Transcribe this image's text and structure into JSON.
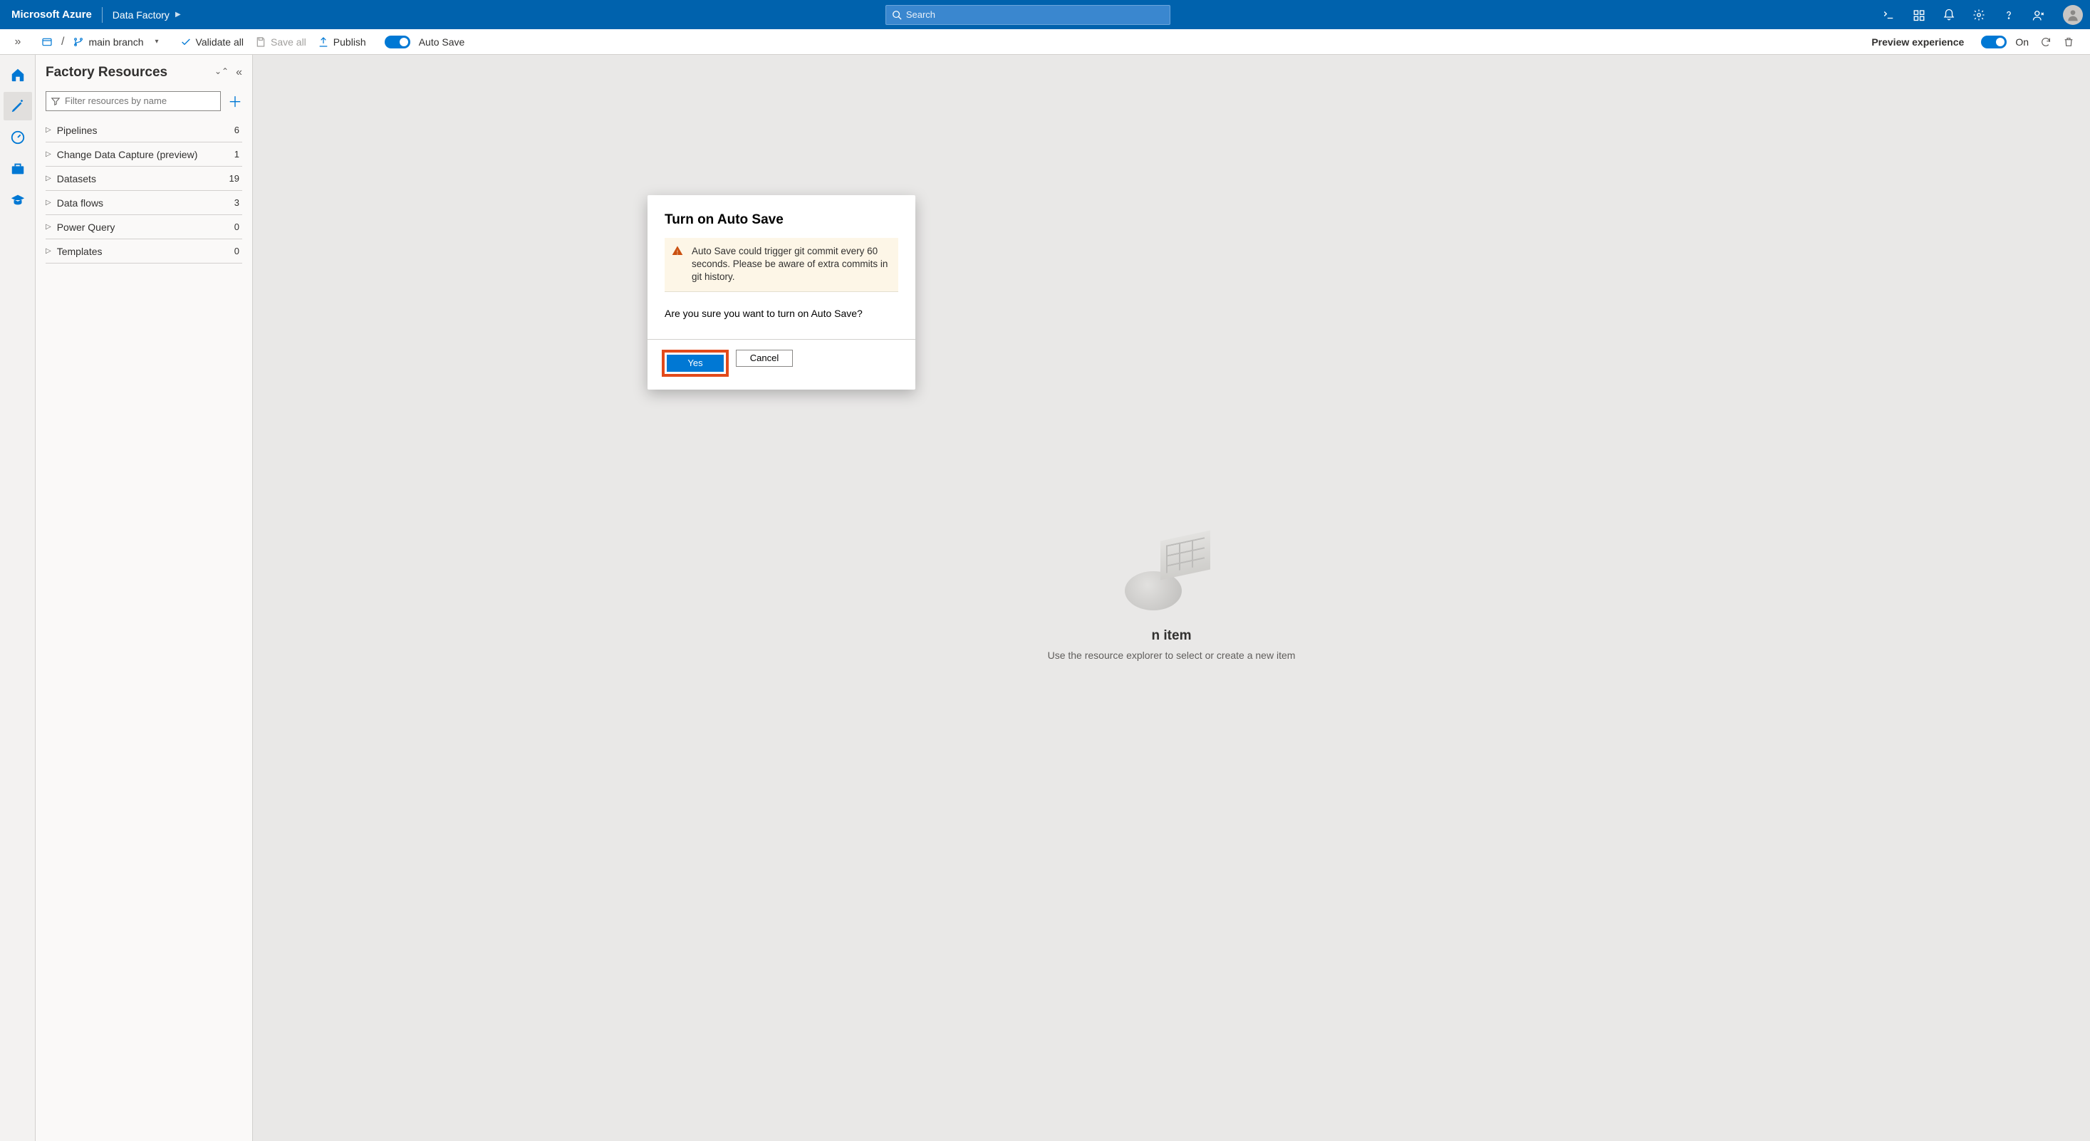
{
  "brand": "Microsoft Azure",
  "breadcrumb": {
    "service": "Data Factory"
  },
  "search": {
    "placeholder": "Search"
  },
  "toolbar": {
    "branch_label": "main branch",
    "validate_label": "Validate all",
    "save_label": "Save all",
    "publish_label": "Publish",
    "autosave_label": "Auto Save",
    "preview_label": "Preview experience",
    "preview_state": "On"
  },
  "panel": {
    "title": "Factory Resources",
    "filter_placeholder": "Filter resources by name",
    "items": [
      {
        "label": "Pipelines",
        "count": "6"
      },
      {
        "label": "Change Data Capture (preview)",
        "count": "1"
      },
      {
        "label": "Datasets",
        "count": "19"
      },
      {
        "label": "Data flows",
        "count": "3"
      },
      {
        "label": "Power Query",
        "count": "0"
      },
      {
        "label": "Templates",
        "count": "0"
      }
    ]
  },
  "canvas": {
    "empty_title_suffix": "n item",
    "empty_sub": "Use the resource explorer to select or create a new item"
  },
  "dialog": {
    "title": "Turn on Auto Save",
    "warning": "Auto Save could trigger git commit every 60 seconds. Please be aware of extra commits in git history.",
    "question": "Are you sure you want to turn on Auto Save?",
    "yes": "Yes",
    "cancel": "Cancel"
  }
}
